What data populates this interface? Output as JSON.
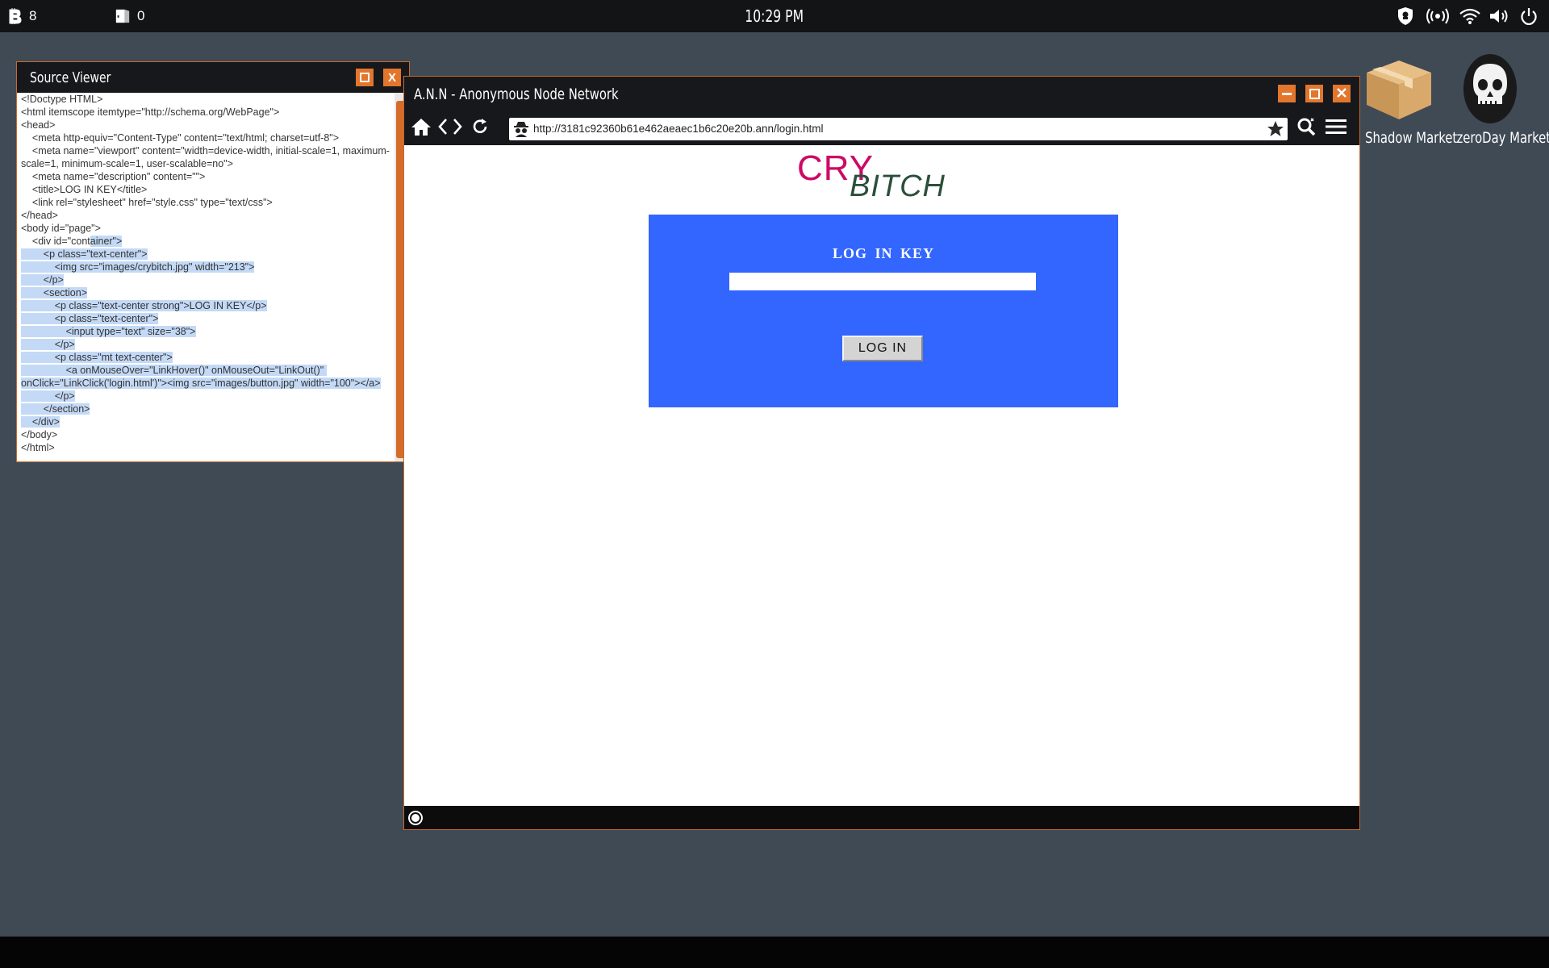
{
  "topbar": {
    "coins_count": "8",
    "doors_count": "0",
    "clock": "10:29 PM",
    "tray_icons": [
      "shield-icon",
      "broadcast-icon",
      "wifi-icon",
      "volume-icon",
      "power-icon"
    ]
  },
  "desktop": {
    "icons": [
      {
        "label": "Shadow Market",
        "icon": "package-icon"
      },
      {
        "label": "zeroDay Market",
        "icon": "skull-icon"
      }
    ]
  },
  "source_viewer": {
    "title": "Source Viewer",
    "maximize_label": "",
    "close_label": "X",
    "lines_plain": "<!Doctype HTML>\n<html itemscope itemtype=\"http://schema.org/WebPage\">\n<head>\n    <meta http-equiv=\"Content-Type\" content=\"text/html; charset=utf-8\">\n    <meta name=\"viewport\" content=\"width=device-width, initial-scale=1, maximum-scale=1, minimum-scale=1, user-scalable=no\">\n    <meta name=\"description\" content=\"\">\n    <title>LOG IN KEY</title>\n    <link rel=\"stylesheet\" href=\"style.css\" type=\"text/css\">\n</head>\n<body id=\"page\">\n    <div id=\"cont",
    "lines_selected": "ainer\">\n        <p class=\"text-center\">\n            <img src=\"images/crybitch.jpg\" width=\"213\">\n        </p>\n        <section>\n            <p class=\"text-center strong\">LOG IN KEY</p>\n            <p class=\"text-center\">\n                <input type=\"text\" size=\"38\">\n            </p>\n            <p class=\"mt text-center\">\n                <a onMouseOver=\"LinkHover()\" onMouseOut=\"LinkOut()\" onClick=\"LinkClick('login.html')\"><img src=\"images/button.jpg\" width=\"100\"></a>\n            </p>\n        </section>\n    </div>",
    "lines_after": "\n</body>\n</html>"
  },
  "browser": {
    "title": "A.N.N - Anonymous Node Network",
    "url": "http://3181c92360b61e462aeaec1b6c20e20b.ann/login.html",
    "page": {
      "logo_word1": "CRY",
      "logo_word2": "BITCH",
      "login_label": "LOG IN KEY",
      "login_value": "",
      "login_button": "LOG IN"
    }
  },
  "colors": {
    "accent": "#e2762d",
    "login_panel": "#3366ff",
    "logo_pink": "#cc0a66",
    "logo_green": "#2b4f3a",
    "desktop_bg": "#3f4a55"
  }
}
